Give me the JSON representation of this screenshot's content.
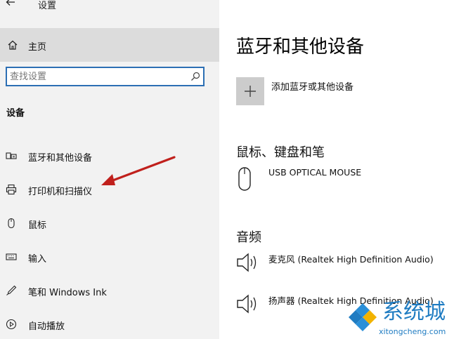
{
  "window": {
    "title": "设置",
    "back_icon": "back-arrow-icon"
  },
  "sidebar": {
    "home_label": "主页",
    "search_placeholder": "查找设置",
    "section_title": "设备",
    "items": [
      {
        "label": "蓝牙和其他设备",
        "icon": "bluetooth-devices-icon"
      },
      {
        "label": "打印机和扫描仪",
        "icon": "printer-icon"
      },
      {
        "label": "鼠标",
        "icon": "mouse-icon"
      },
      {
        "label": "输入",
        "icon": "keyboard-icon"
      },
      {
        "label": "笔和 Windows Ink",
        "icon": "pen-icon"
      },
      {
        "label": "自动播放",
        "icon": "autoplay-icon"
      }
    ]
  },
  "main": {
    "title": "蓝牙和其他设备",
    "add_device_label": "添加蓝牙或其他设备",
    "sections": [
      {
        "title": "鼠标、键盘和笔",
        "devices": [
          {
            "name": "USB OPTICAL MOUSE",
            "icon": "mouse-icon"
          }
        ]
      },
      {
        "title": "音频",
        "devices": [
          {
            "name": "麦克风 (Realtek High Definition Audio)",
            "icon": "speaker-icon"
          },
          {
            "name": "扬声器 (Realtek High Definition Audio)",
            "icon": "speaker-icon"
          }
        ]
      }
    ]
  },
  "watermark": {
    "text": "系统城",
    "url": "xitongcheng.com"
  },
  "colors": {
    "accent": "#2c6fb4",
    "sidebar_bg": "#f2f2f2",
    "selected_bg": "#dcdcdc",
    "arrow": "#c0201c",
    "watermark": "#1f7cc2"
  }
}
